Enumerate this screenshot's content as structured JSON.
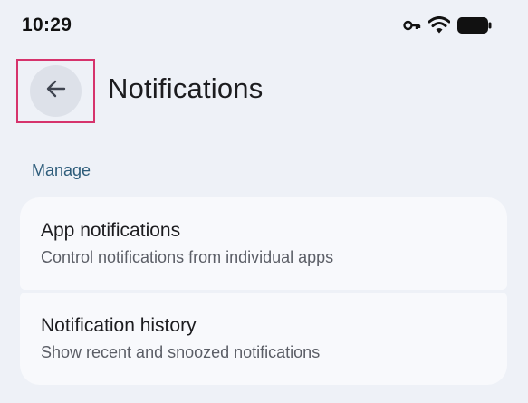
{
  "status_bar": {
    "time": "10:29",
    "icons": [
      "vpn-key-icon",
      "wifi-icon",
      "battery-icon"
    ]
  },
  "app_bar": {
    "back_icon": "arrow-left-icon",
    "title": "Notifications"
  },
  "section": {
    "header": "Manage"
  },
  "items": [
    {
      "title": "App notifications",
      "subtitle": "Control notifications from individual apps"
    },
    {
      "title": "Notification history",
      "subtitle": "Show recent and snoozed notifications"
    }
  ],
  "colors": {
    "background": "#eef1f7",
    "card": "#f8f9fc",
    "section_header": "#2d5c7a",
    "highlight": "#d6336c",
    "back_button_bg": "#dde1e9"
  }
}
